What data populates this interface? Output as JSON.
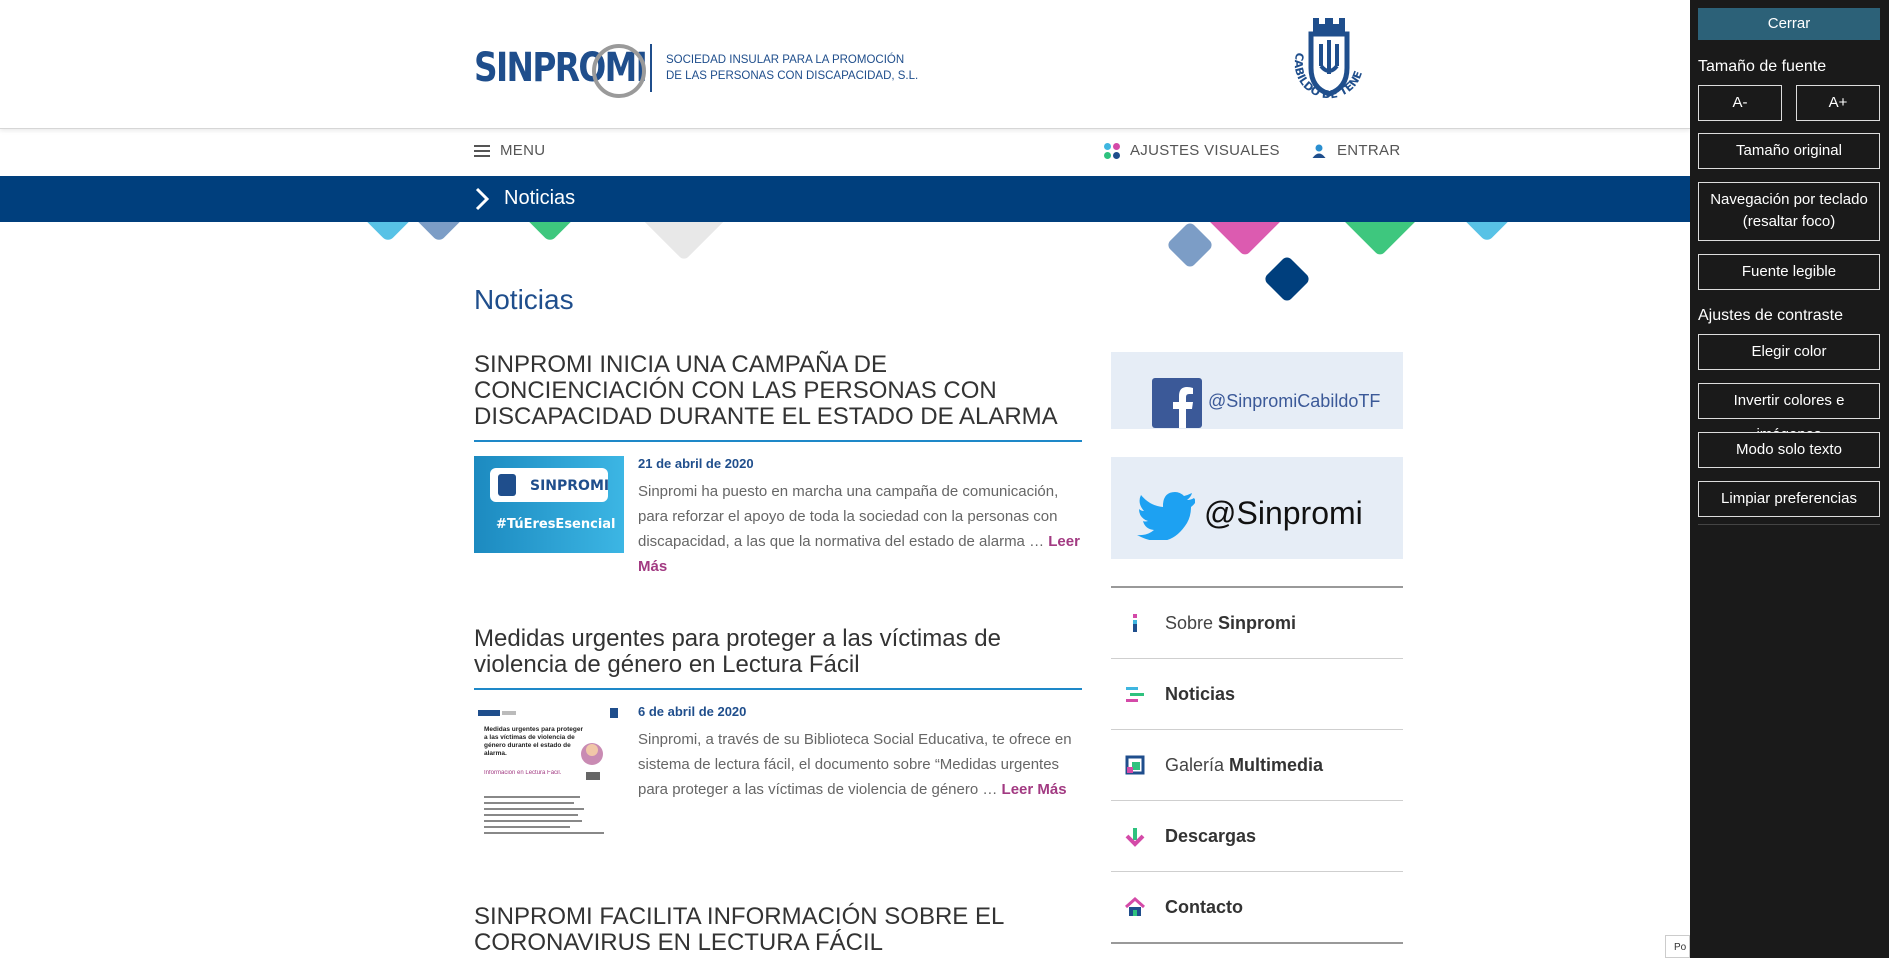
{
  "header": {
    "logo_text": "SINPROMI",
    "logo_subtitle_1": "SOCIEDAD INSULAR PARA LA PROMOCIÓN",
    "logo_subtitle_2": "DE LAS PERSONAS CON DISCAPACIDAD, S.L.",
    "cabildo_text": "CABILDO DE TENERIFE"
  },
  "nav": {
    "menu_label": "MENU",
    "ajustes_label": "AJUSTES VISUALES",
    "entrar_label": "ENTRAR"
  },
  "breadcrumb": {
    "current": "Noticias"
  },
  "page": {
    "title": "Noticias"
  },
  "articles": [
    {
      "title": "SINPROMI INICIA UNA CAMPAÑA DE CONCIENCIACIÓN CON LAS PERSONAS CON DISCAPACIDAD DURANTE EL ESTADO DE ALARMA",
      "date": "21 de abril de 2020",
      "excerpt": "Sinpromi  ha puesto en marcha una campaña de comunicación, para reforzar el apoyo de toda la sociedad con la personas con discapacidad, a las que la normativa del estado de alarma …",
      "read_more": "Leer Más",
      "thumb": {
        "logo": "SINPROMI",
        "hashtag": "#TúEresEsencial"
      }
    },
    {
      "title": "Medidas urgentes para proteger a las víctimas de violencia de género en Lectura Fácil",
      "date": "6 de abril de 2020",
      "excerpt": "Sinpromi, a través de su Biblioteca Social Educativa, te ofrece en sistema de lectura fácil, el documento sobre “Medidas urgentes para proteger a las víctimas de violencia de género …",
      "read_more": "Leer Más",
      "thumb": {
        "heading": "Medidas urgentes para proteger a las víctimas de violencia de género durante el estado de alarma.",
        "sub": "Información en Lectura Fácil."
      }
    },
    {
      "title": "SINPROMI FACILITA INFORMACIÓN SOBRE EL CORONAVIRUS EN LECTURA FÁCIL"
    }
  ],
  "sidebar": {
    "facebook_handle": "@SinpromiCabildoTF",
    "twitter_handle": "@Sinpromi",
    "menu": [
      {
        "prefix": "Sobre ",
        "bold": "Sinpromi",
        "icon": "info-icon"
      },
      {
        "prefix": "",
        "bold": "Noticias",
        "icon": "news-icon"
      },
      {
        "prefix": "Galería ",
        "bold": "Multimedia",
        "icon": "gallery-icon"
      },
      {
        "prefix": "",
        "bold": "Descargas",
        "icon": "download-icon"
      },
      {
        "prefix": "",
        "bold": "Contacto",
        "icon": "home-icon"
      }
    ]
  },
  "accessibility_panel": {
    "close_label": "Cerrar",
    "font_size_heading": "Tamaño de fuente",
    "decrease_label": "A-",
    "increase_label": "A+",
    "original_size_label": "Tamaño original",
    "keyboard_nav_label": "Navegación por teclado (resaltar foco)",
    "readable_font_label": "Fuente legible",
    "contrast_heading": "Ajustes de contraste",
    "choose_color_label": "Elegir color",
    "invert_label": "Invertir colores e imágenes",
    "text_only_label": "Modo solo texto",
    "clear_prefs_label": "Limpiar preferencias"
  },
  "corner_badge": "Po",
  "colors": {
    "brand_blue": "#003f7d",
    "link_magenta": "#a23a82",
    "panel_bg": "#1a1a1a",
    "panel_close": "#2c6178"
  }
}
